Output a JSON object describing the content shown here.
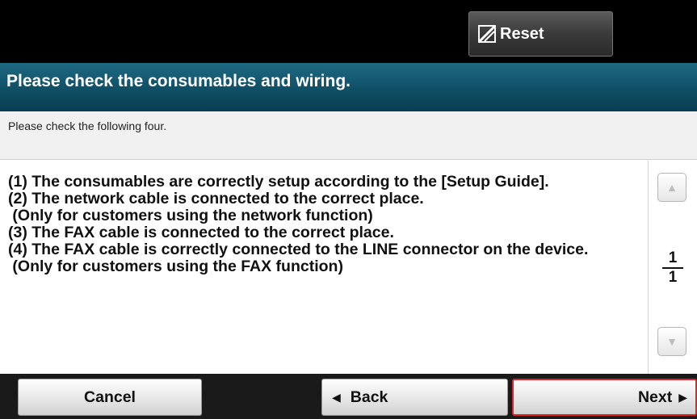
{
  "header": {
    "reset_label": "Reset"
  },
  "title": "Please check the consumables and wiring.",
  "subtitle": "Please check the following four.",
  "instructions": [
    "(1) The consumables are correctly setup according to the [Setup Guide].",
    "(2) The network cable is connected to the correct place.",
    " (Only for customers using the network function)",
    "(3) The FAX cable is connected to the correct place.",
    "(4) The FAX cable is correctly connected to the LINE connector on the device.",
    " (Only for customers using the FAX function)"
  ],
  "pagination": {
    "current": "1",
    "total": "1",
    "up_icon": "triangle-up",
    "down_icon": "triangle-down"
  },
  "footer": {
    "cancel_label": "Cancel",
    "back_label": "Back",
    "next_label": "Next",
    "back_icon": "triangle-left",
    "next_icon": "triangle-right"
  },
  "colors": {
    "title_bar": "#0f4f66",
    "next_highlight": "#e0242b"
  }
}
